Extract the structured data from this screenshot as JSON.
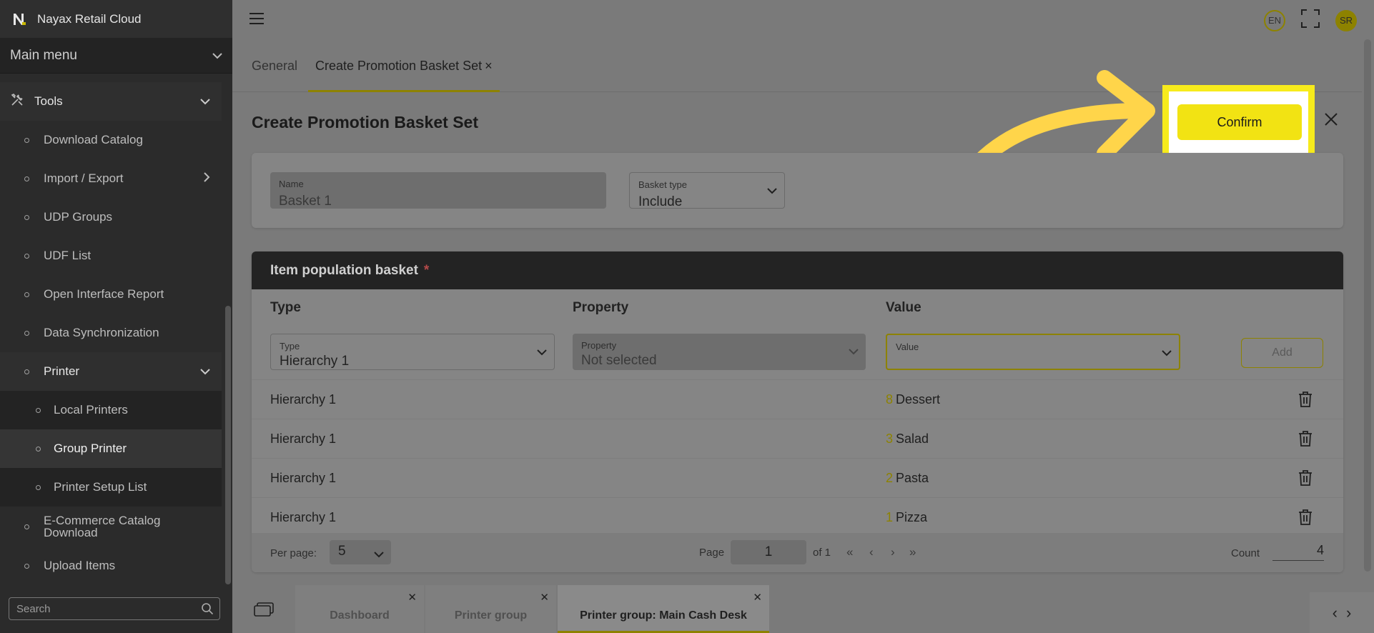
{
  "app": {
    "name": "Nayax Retail Cloud",
    "main_menu_label": "Main menu"
  },
  "sidebar": {
    "tools_label": "Tools",
    "items": [
      {
        "label": "Download Catalog"
      },
      {
        "label": "Import / Export"
      },
      {
        "label": "UDP Groups"
      },
      {
        "label": "UDF List"
      },
      {
        "label": "Open Interface Report"
      },
      {
        "label": "Data Synchronization"
      },
      {
        "label": "Printer"
      },
      {
        "label": "Local Printers"
      },
      {
        "label": "Group Printer"
      },
      {
        "label": "Printer Setup List"
      },
      {
        "label": "E-Commerce Catalog Download"
      },
      {
        "label": "Upload Items"
      }
    ],
    "search_placeholder": "Search"
  },
  "topbar": {
    "lang": "EN",
    "avatar": "SR"
  },
  "tabs": {
    "general": "General",
    "create": "Create Promotion Basket Set"
  },
  "page": {
    "title": "Create Promotion Basket Set",
    "confirm_label": "Confirm",
    "name_label": "Name",
    "name_value": "Basket 1",
    "basket_type_label": "Basket type",
    "basket_type_value": "Include"
  },
  "basket": {
    "title": "Item population basket",
    "required_mark": "*",
    "columns": {
      "type": "Type",
      "property": "Property",
      "value": "Value"
    },
    "filters": {
      "type_label": "Type",
      "type_value": "Hierarchy 1",
      "property_label": "Property",
      "property_value": "Not selected",
      "value_label": "Value",
      "value_value": ""
    },
    "add_label": "Add",
    "rows": [
      {
        "type": "Hierarchy 1",
        "code": "8",
        "value": "Dessert"
      },
      {
        "type": "Hierarchy 1",
        "code": "3",
        "value": "Salad"
      },
      {
        "type": "Hierarchy 1",
        "code": "2",
        "value": "Pasta"
      },
      {
        "type": "Hierarchy 1",
        "code": "1",
        "value": "Pizza"
      }
    ],
    "pager": {
      "per_page_label": "Per page:",
      "per_page_value": "5",
      "page_label": "Page",
      "page_value": "1",
      "of_label": "of 1",
      "count_label": "Count",
      "count_value": "4"
    }
  },
  "bottom_tabs": [
    {
      "label": "Dashboard"
    },
    {
      "label": "Printer group"
    },
    {
      "label": "Printer group: Main Cash Desk"
    }
  ],
  "colors": {
    "accent": "#f2e313",
    "highlight_frame": "#f7eb1c",
    "arrow": "#ffd54a"
  }
}
